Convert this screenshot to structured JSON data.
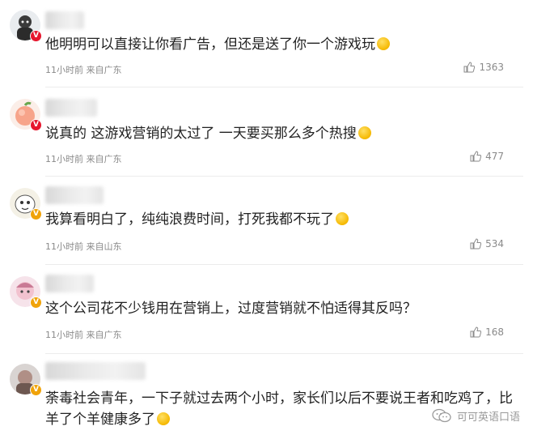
{
  "comments": [
    {
      "text": "他明明可以直接让你看广告，但还是送了你一个游戏玩",
      "emoji": "crying-laughing-emoji",
      "meta": "11小时前 来自广东",
      "likes": "1363",
      "badge": "red"
    },
    {
      "text": "说真的 这游戏营销的太过了 一天要买那么多个热搜",
      "emoji": "crying-face-emoji",
      "meta": "11小时前 来自广东",
      "likes": "477",
      "badge": "red"
    },
    {
      "text": "我算看明白了，纯纯浪费时间，打死我都不玩了",
      "emoji": "crying-laughing-emoji",
      "meta": "11小时前 来自山东",
      "likes": "534",
      "badge": "gold"
    },
    {
      "text": "这个公司花不少钱用在营销上，过度营销就不怕适得其反吗？",
      "emoji": "",
      "meta": "11小时前 来自广东",
      "likes": "168",
      "badge": "gold"
    },
    {
      "text": "荼毒社会青年，一下子就过去两个小时，家长们以后不要说王者和吃鸡了，比羊了个羊健康多了",
      "emoji": "smile-emoji",
      "meta": "",
      "likes": "",
      "badge": "gold"
    }
  ],
  "watermark": {
    "label": "可可英语口语",
    "icon": "wechat-icon"
  },
  "badge_letter": "V",
  "colors": {
    "badge_red": "#e6162d",
    "badge_gold": "#f0a30a",
    "meta_gray": "#8a8a8a",
    "text": "#222222"
  }
}
